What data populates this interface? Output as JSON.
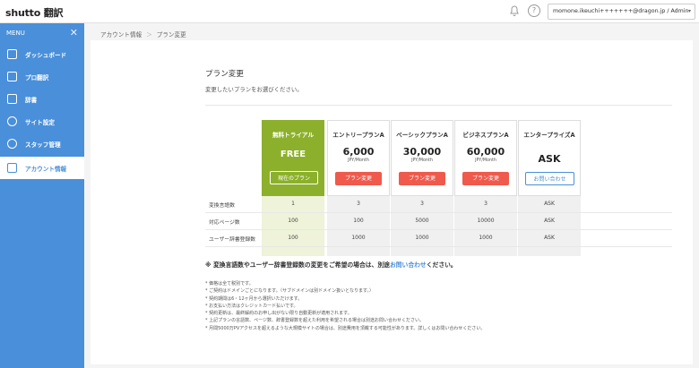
{
  "header": {
    "logo_text": "shutto 翻訳",
    "user_menu": "momone.ikeuchi+++++++@dragon.jp / Admin",
    "dropdown_glyph": "▾",
    "help_glyph": "?",
    "icons": [
      "bell-icon",
      "help-icon"
    ]
  },
  "sidebar": {
    "menu_label": "MENU",
    "close_glyph": "✕",
    "items": [
      {
        "label": "ダッシュボード",
        "icon": "home-icon"
      },
      {
        "label": "プロ翻訳",
        "icon": "chat-icon"
      },
      {
        "label": "辞書",
        "icon": "book-icon"
      },
      {
        "label": "サイト設定",
        "icon": "gear-icon"
      },
      {
        "label": "スタッフ管理",
        "icon": "users-icon"
      },
      {
        "label": "アカウント情報",
        "icon": "document-icon",
        "active": true
      }
    ]
  },
  "breadcrumb": {
    "items": [
      "アカウント情報",
      "プラン変更"
    ],
    "separator": "＞"
  },
  "main": {
    "title": "プラン変更",
    "subtitle": "変更したいプランをお選びください。",
    "plans": [
      {
        "name": "無料トライアル",
        "price": "FREE",
        "unit": "",
        "button": "現在のプラン"
      },
      {
        "name": "エントリープランA",
        "price": "6,000",
        "unit": "JPY/Month",
        "button": "プラン変更"
      },
      {
        "name": "ベーシックプランA",
        "price": "30,000",
        "unit": "JPY/Month",
        "button": "プラン変更"
      },
      {
        "name": "ビジネスプランA",
        "price": "60,000",
        "unit": "JPY/Month",
        "button": "プラン変更"
      },
      {
        "name": "エンタープライズA",
        "price": "ASK",
        "unit": "",
        "button": "お問い合わせ"
      }
    ],
    "rows": [
      {
        "label": "変換言語数",
        "values": [
          "1",
          "3",
          "3",
          "3",
          "ASK"
        ]
      },
      {
        "label": "対応ページ数",
        "values": [
          "100",
          "100",
          "5000",
          "10000",
          "ASK"
        ]
      },
      {
        "label": "ユーザー辞書登録数",
        "values": [
          "100",
          "1000",
          "1000",
          "1000",
          "ASK"
        ]
      }
    ],
    "note_prefix": "※ 変換言語数やユーザー辞書登録数の変更をご希望の場合は、別途",
    "note_link": "お問い合わせ",
    "note_suffix": "ください。",
    "fine_print": [
      "* 価格は全て税別です。",
      "* ご契約はドメインごとになります。（サブドメインは別ドメイン扱いとなります。）",
      "* 契約期間は6・12ヶ月から選択いただけます。",
      "* お支払い方法はクレジットカード払いです。",
      "* 契約更新は、最終解約のお申し出がない限り自動更新が適用されます。",
      "* 上記プランの言語数、ページ数、辞書登録数を超えた利用を希望される場合は別途お問い合わせください。",
      "* 月間5000万PVアクセスを超えるような大規模サイトの場合は、別途費用を頂戴する可能性があります。詳しくはお問い合わせください。"
    ],
    "colors": {
      "free": "#8cb02b",
      "change": "#ef5a4c",
      "accent": "#4a8fd9"
    }
  }
}
